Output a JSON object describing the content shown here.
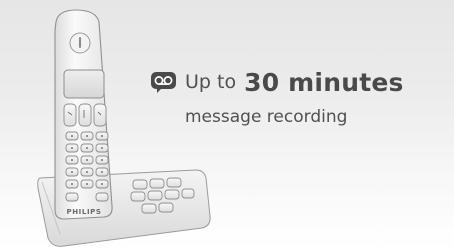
{
  "headline": {
    "icon": "voicemail-icon",
    "prefix": "Up to",
    "highlight": "30 minutes",
    "subtitle": "message recording"
  },
  "product": {
    "brand": "PHILIPS"
  },
  "colors": {
    "text": "#4a4a4a",
    "icon": "#4a4a4a",
    "background_top": "#e6e6e6",
    "background_bottom": "#ffffff"
  }
}
